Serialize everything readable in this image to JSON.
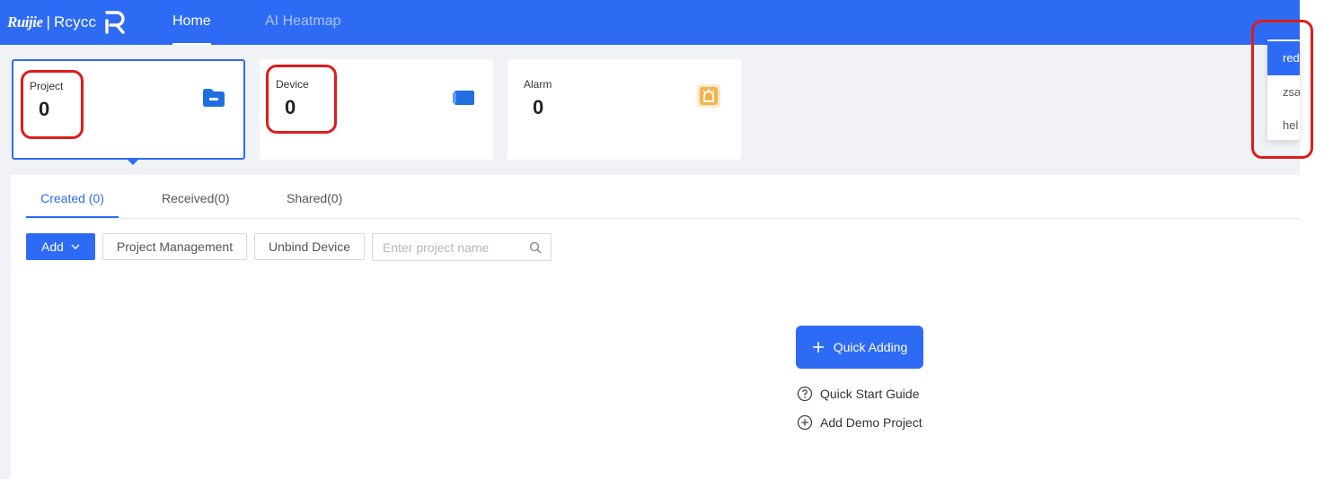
{
  "header": {
    "brand": "Ruijie",
    "separator": "|",
    "product": "Rcycc",
    "nav": [
      {
        "label": "Home",
        "active": true
      },
      {
        "label": "AI Heatmap",
        "active": false
      }
    ],
    "colors": {
      "bar": "#2e6bf5",
      "nav_active": "#ffffff"
    }
  },
  "stats": {
    "cards": [
      {
        "label": "Project",
        "count": "0",
        "icon": "folder-icon",
        "selected": true
      },
      {
        "label": "Device",
        "count": "0",
        "icon": "device-icon",
        "selected": false
      },
      {
        "label": "Alarm",
        "count": "0",
        "icon": "alarm-icon",
        "selected": false
      }
    ]
  },
  "tabs": [
    {
      "label": "Created (0)",
      "active": true
    },
    {
      "label": "Received(0)",
      "active": false
    },
    {
      "label": "Shared(0)",
      "active": false
    }
  ],
  "toolbar": {
    "add_label": "Add",
    "project_management_label": "Project Management",
    "unbind_device_label": "Unbind Device",
    "search_placeholder": "Enter project name",
    "search_value": ""
  },
  "empty_state": {
    "quick_adding_label": "Quick Adding",
    "quick_start_label": "Quick Start Guide",
    "demo_project_label": "Add Demo Project"
  },
  "account_menu": {
    "items": [
      {
        "label": "red",
        "selected": true
      },
      {
        "label": "zsa",
        "selected": false
      },
      {
        "label": "hel",
        "selected": false
      }
    ]
  },
  "annotations": {
    "color": "#e01b1b"
  }
}
